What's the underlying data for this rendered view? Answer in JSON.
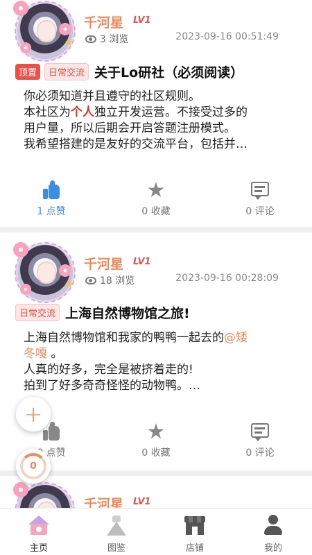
{
  "posts": [
    {
      "username": "千河星",
      "level": "LV1",
      "views": "3 浏览",
      "timestamp": "2023-09-16 00:51:49",
      "tags": [
        "顶置",
        "日常交流"
      ],
      "title": "关于Lo研社（必须阅读）",
      "body_lines": [
        "你必须知道并且遵守的社区规则。",
        "本社区为个人独立开发运营。不接受过多的",
        "用户量，所以后期会开启答题注册模式。",
        "我希望搭建的是友好的交流平台，包括并…"
      ],
      "body_highlight": "个人",
      "likes": "1 点赞",
      "favorites": "0 收藏",
      "comments": "0 评论",
      "liked": true
    },
    {
      "username": "千河星",
      "level": "LV1",
      "views": "18 浏览",
      "timestamp": "2023-09-16 00:28:09",
      "tags": [
        "日常交流"
      ],
      "title": "上海自然博物馆之旅!",
      "body_lines": [
        "上海自然博物馆和我家的鸭鸭一起去的@矮",
        "冬嘎 。",
        "人真的好多，完全是被挤着走的!",
        "拍到了好多奇奇怪怪的动物鸭。…"
      ],
      "mention": "@矮冬嘎",
      "likes": "0 点赞",
      "favorites": "0 收藏",
      "comments": "0 评论",
      "liked": false
    },
    {
      "username": "千河星",
      "level": "LV1"
    }
  ],
  "fab": {
    "add_symbol": "+",
    "progress_count": "0"
  },
  "tabbar": {
    "items": [
      {
        "label": "主页",
        "icon": "home-icon",
        "active": true
      },
      {
        "label": "图鉴",
        "icon": "dress-icon",
        "active": false
      },
      {
        "label": "店铺",
        "icon": "shop-icon",
        "active": false
      },
      {
        "label": "我的",
        "icon": "user-icon",
        "active": false
      }
    ]
  },
  "colors": {
    "accent": "#f08a5d",
    "level": "#e8524a",
    "like_active": "#3d8ee0",
    "tag_top_bg": "#e8524a",
    "highlight": "#d9302c"
  }
}
